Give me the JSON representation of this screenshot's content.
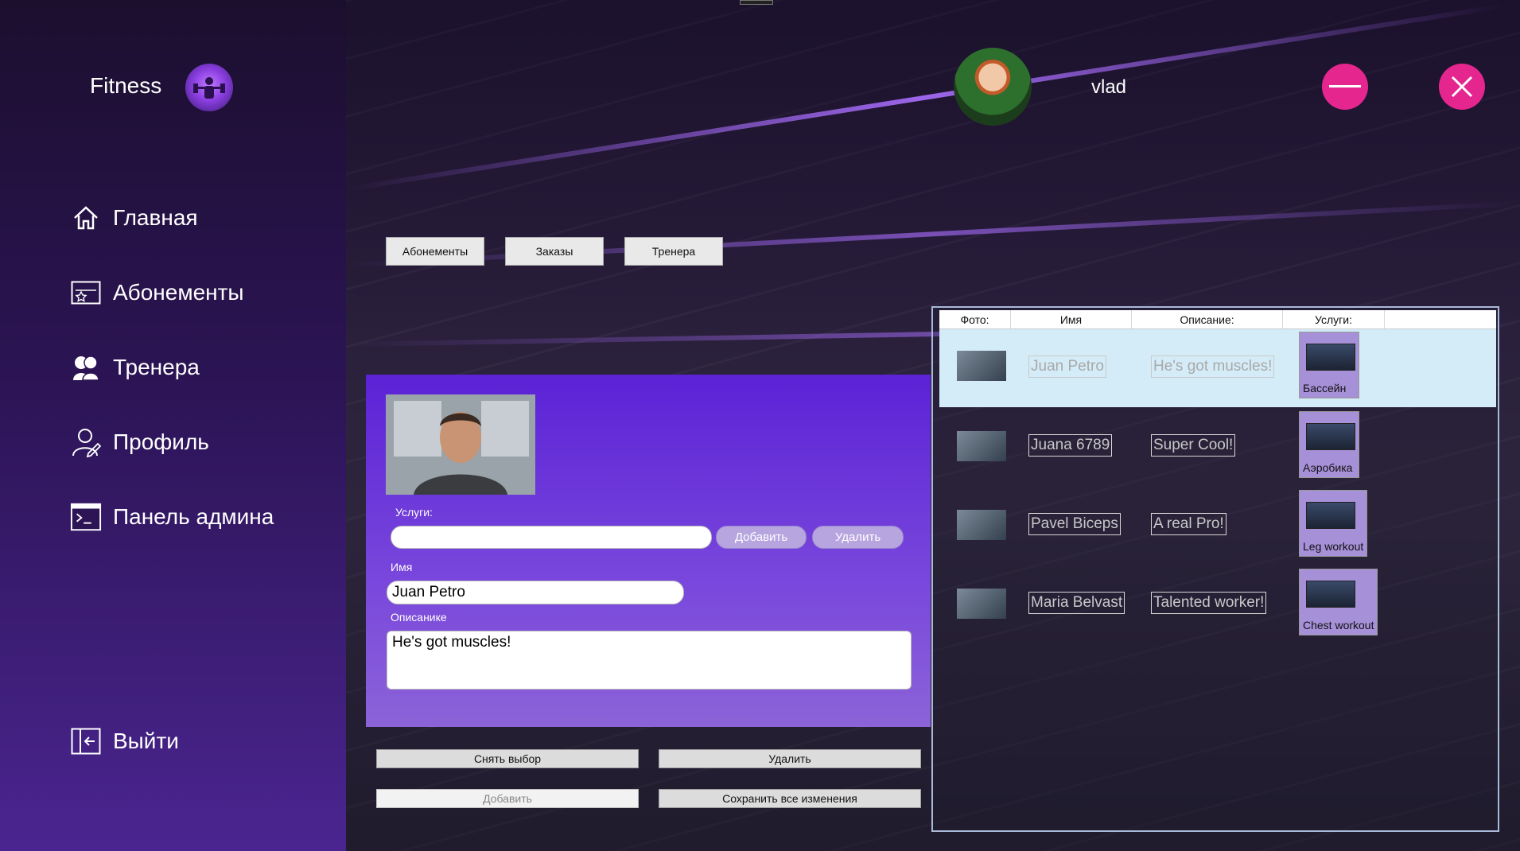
{
  "app": {
    "title": "Fitness"
  },
  "sidebar": {
    "items": [
      {
        "label": "Главная",
        "icon": "home-icon"
      },
      {
        "label": "Абонементы",
        "icon": "membership-card-icon"
      },
      {
        "label": "Тренера",
        "icon": "trainers-icon"
      },
      {
        "label": "Профиль",
        "icon": "profile-icon"
      },
      {
        "label": "Панель админа",
        "icon": "terminal-icon"
      }
    ],
    "logout": {
      "label": "Выйти",
      "icon": "logout-icon"
    }
  },
  "header": {
    "username": "vlad",
    "minimize_icon": "minimize-icon",
    "close_icon": "close-icon",
    "accent": "#e6268f"
  },
  "tabs": [
    "Абонементы",
    "Заказы",
    "Тренера"
  ],
  "editor": {
    "services_label": "Услуги:",
    "services_value": "",
    "add_label": "Добавить",
    "remove_label": "Удалить",
    "name_label": "Имя",
    "name_value": "Juan Petro",
    "description_label": "Описанике",
    "description_value": "He's got muscles!"
  },
  "actions": {
    "deselect": "Снять выбор",
    "delete": "Удалить",
    "add": "Добавить",
    "save_all": "Сохранить все изменения"
  },
  "grid": {
    "columns": [
      "Фото:",
      "Имя",
      "Описание:",
      "Услуги:"
    ],
    "rows": [
      {
        "name": "Juan Petro",
        "description": "He's got muscles!",
        "service": "Бассейн",
        "selected": true
      },
      {
        "name": "Juana 6789",
        "description": "Super Cool!",
        "service": "Аэробика",
        "selected": false
      },
      {
        "name": "Pavel Biceps",
        "description": "A real Pro!",
        "service": "Leg workout",
        "selected": false
      },
      {
        "name": "Maria Belvast",
        "description": "Talented worker!",
        "service": "Chest workout",
        "selected": false
      }
    ]
  }
}
